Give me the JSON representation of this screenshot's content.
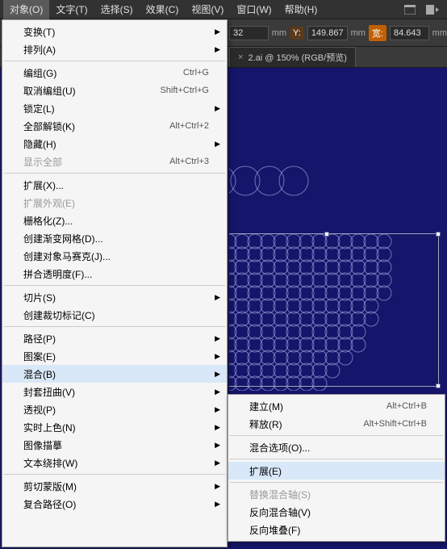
{
  "menubar": {
    "items": [
      "对象(O)",
      "文字(T)",
      "选择(S)",
      "效果(C)",
      "视图(V)",
      "窗口(W)",
      "帮助(H)"
    ]
  },
  "controlbar": {
    "val1": "32",
    "y_label": "Y:",
    "y_val": "149.867",
    "w_label": "宽:",
    "w_val": "84.643",
    "unit": "mm"
  },
  "tab": {
    "title": "2.ai @ 150% (RGB/预览)"
  },
  "main_menu": [
    {
      "type": "item",
      "label": "变换(T)",
      "arrow": true
    },
    {
      "type": "item",
      "label": "排列(A)",
      "arrow": true
    },
    {
      "type": "sep"
    },
    {
      "type": "item",
      "label": "编组(G)",
      "shortcut": "Ctrl+G"
    },
    {
      "type": "item",
      "label": "取消编组(U)",
      "shortcut": "Shift+Ctrl+G"
    },
    {
      "type": "item",
      "label": "锁定(L)",
      "arrow": true
    },
    {
      "type": "item",
      "label": "全部解锁(K)",
      "shortcut": "Alt+Ctrl+2"
    },
    {
      "type": "item",
      "label": "隐藏(H)",
      "arrow": true
    },
    {
      "type": "item",
      "label": "显示全部",
      "shortcut": "Alt+Ctrl+3",
      "disabled": true
    },
    {
      "type": "sep"
    },
    {
      "type": "item",
      "label": "扩展(X)..."
    },
    {
      "type": "item",
      "label": "扩展外观(E)",
      "disabled": true
    },
    {
      "type": "item",
      "label": "栅格化(Z)..."
    },
    {
      "type": "item",
      "label": "创建渐变网格(D)..."
    },
    {
      "type": "item",
      "label": "创建对象马赛克(J)..."
    },
    {
      "type": "item",
      "label": "拼合透明度(F)..."
    },
    {
      "type": "sep"
    },
    {
      "type": "item",
      "label": "切片(S)",
      "arrow": true
    },
    {
      "type": "item",
      "label": "创建裁切标记(C)"
    },
    {
      "type": "sep"
    },
    {
      "type": "item",
      "label": "路径(P)",
      "arrow": true
    },
    {
      "type": "item",
      "label": "图案(E)",
      "arrow": true
    },
    {
      "type": "item",
      "label": "混合(B)",
      "arrow": true,
      "highlight": true
    },
    {
      "type": "item",
      "label": "封套扭曲(V)",
      "arrow": true
    },
    {
      "type": "item",
      "label": "透视(P)",
      "arrow": true
    },
    {
      "type": "item",
      "label": "实时上色(N)",
      "arrow": true
    },
    {
      "type": "item",
      "label": "图像描摹",
      "arrow": true
    },
    {
      "type": "item",
      "label": "文本绕排(W)",
      "arrow": true
    },
    {
      "type": "sep"
    },
    {
      "type": "item",
      "label": "剪切蒙版(M)",
      "arrow": true
    },
    {
      "type": "item",
      "label": "复合路径(O)",
      "arrow": true
    }
  ],
  "sub_menu": [
    {
      "type": "item",
      "label": "建立(M)",
      "shortcut": "Alt+Ctrl+B"
    },
    {
      "type": "item",
      "label": "释放(R)",
      "shortcut": "Alt+Shift+Ctrl+B"
    },
    {
      "type": "sep"
    },
    {
      "type": "item",
      "label": "混合选项(O)..."
    },
    {
      "type": "sep"
    },
    {
      "type": "item",
      "label": "扩展(E)",
      "highlight": true
    },
    {
      "type": "sep"
    },
    {
      "type": "item",
      "label": "替换混合轴(S)",
      "disabled": true
    },
    {
      "type": "item",
      "label": "反向混合轴(V)"
    },
    {
      "type": "item",
      "label": "反向堆叠(F)"
    }
  ]
}
